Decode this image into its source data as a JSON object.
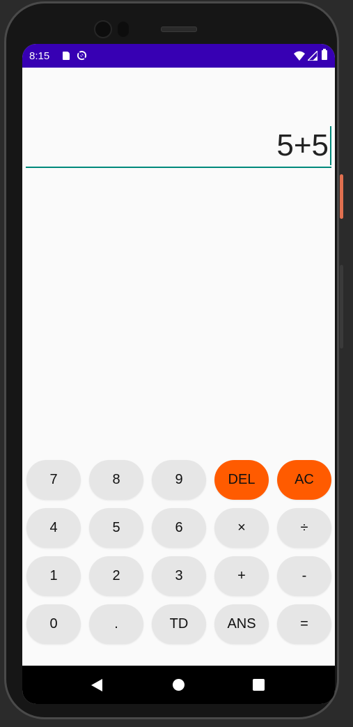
{
  "status_bar": {
    "time": "8:15",
    "color": "#3700b3",
    "icons": [
      "sd-card-icon",
      "sync-icon",
      "wifi-icon",
      "signal-icon",
      "battery-icon"
    ]
  },
  "display": {
    "expression": "5+5",
    "underline_color": "#00897b"
  },
  "keypad": {
    "rows": [
      [
        "7",
        "8",
        "9",
        "DEL",
        "AC"
      ],
      [
        "4",
        "5",
        "6",
        "×",
        "÷"
      ],
      [
        "1",
        "2",
        "3",
        "+",
        "-"
      ],
      [
        "0",
        ".",
        "TD",
        "ANS",
        "="
      ]
    ],
    "accent_color": "#ff5b00",
    "key_color": "#e6e6e6"
  },
  "nav_bar": {
    "icons": [
      "back-icon",
      "home-icon",
      "recent-apps-icon"
    ]
  }
}
